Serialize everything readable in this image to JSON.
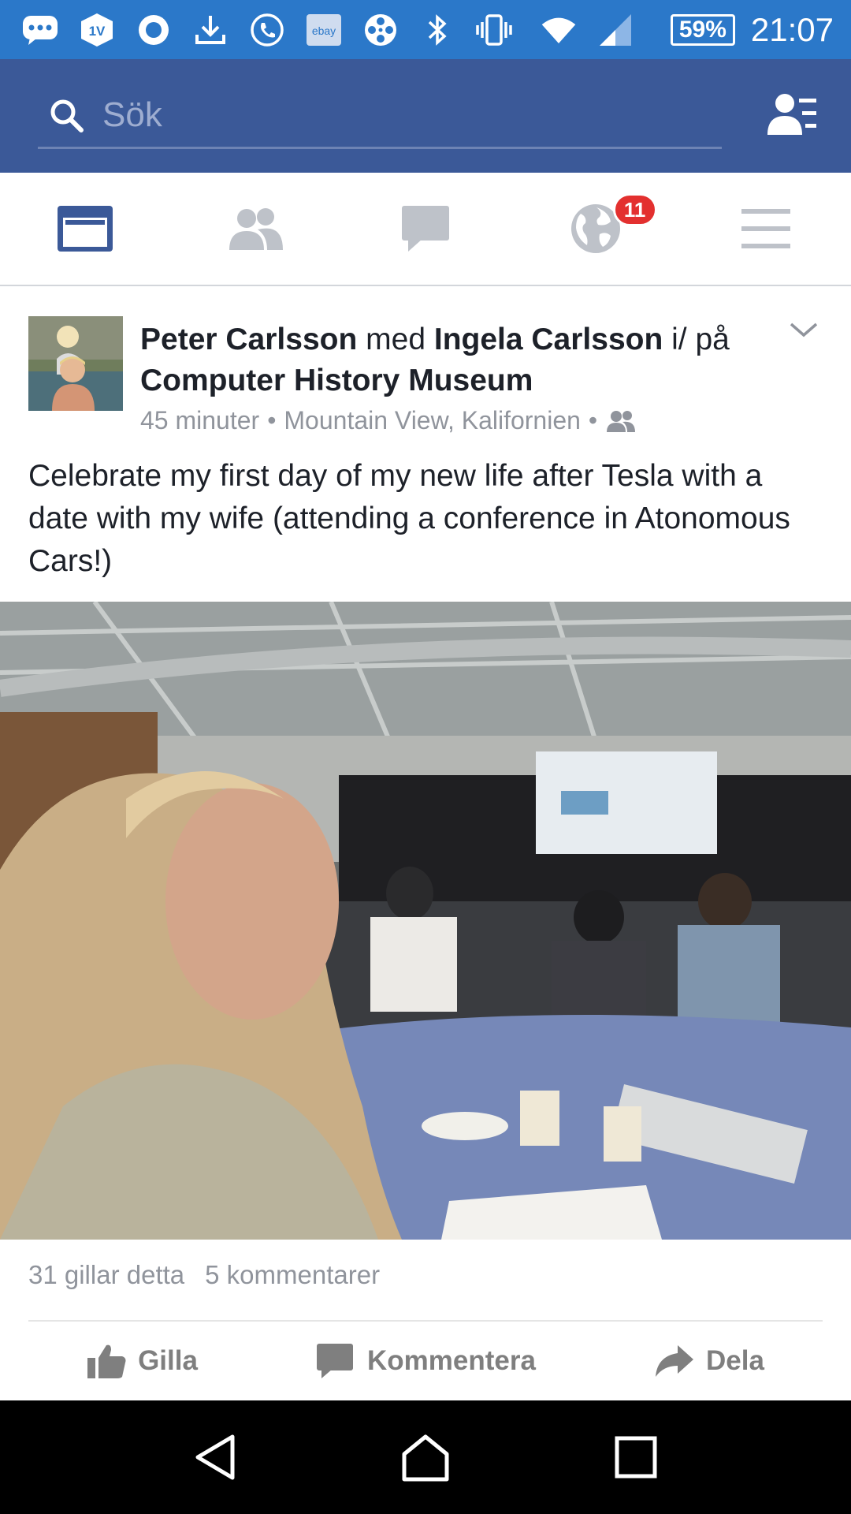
{
  "status_bar": {
    "icons": [
      "chat-bubble-icon",
      "tv-app-icon",
      "circle-icon",
      "download-icon",
      "phone-call-icon",
      "ebay-icon",
      "film-reel-icon",
      "bluetooth-icon",
      "vibrate-icon",
      "wifi-icon",
      "signal-icon"
    ],
    "ebay_label": "ebay",
    "tv_label": "1V",
    "battery": "59%",
    "time": "21:07"
  },
  "search": {
    "placeholder": "Sök"
  },
  "tabs": [
    {
      "name": "news-feed",
      "icon": "news-feed-icon",
      "active": true
    },
    {
      "name": "friends",
      "icon": "friends-icon"
    },
    {
      "name": "messages",
      "icon": "message-icon"
    },
    {
      "name": "notifications",
      "icon": "globe-icon",
      "badge": "11"
    },
    {
      "name": "menu",
      "icon": "hamburger-icon"
    }
  ],
  "post": {
    "author": "Peter Carlsson",
    "with_text": "med",
    "tagged": "Ingela Carlsson",
    "at_text": "i/ på",
    "place": "Computer History Museum",
    "time": "45 minuter",
    "location": "Mountain View, Kalifornien",
    "separator": "•",
    "text": "Celebrate my first day of my new life after Tesla with a date with my wife (attending a conference in Atonomous Cars!)",
    "likes": "31 gillar detta",
    "comments": "5 kommentarer"
  },
  "actions": {
    "like": "Gilla",
    "comment": "Kommentera",
    "share": "Dela"
  },
  "colors": {
    "status_bar": "#2b78c9",
    "header": "#3b5998",
    "active_tab": "#3b5998",
    "badge": "#e3302f",
    "muted_text": "#90949c"
  }
}
